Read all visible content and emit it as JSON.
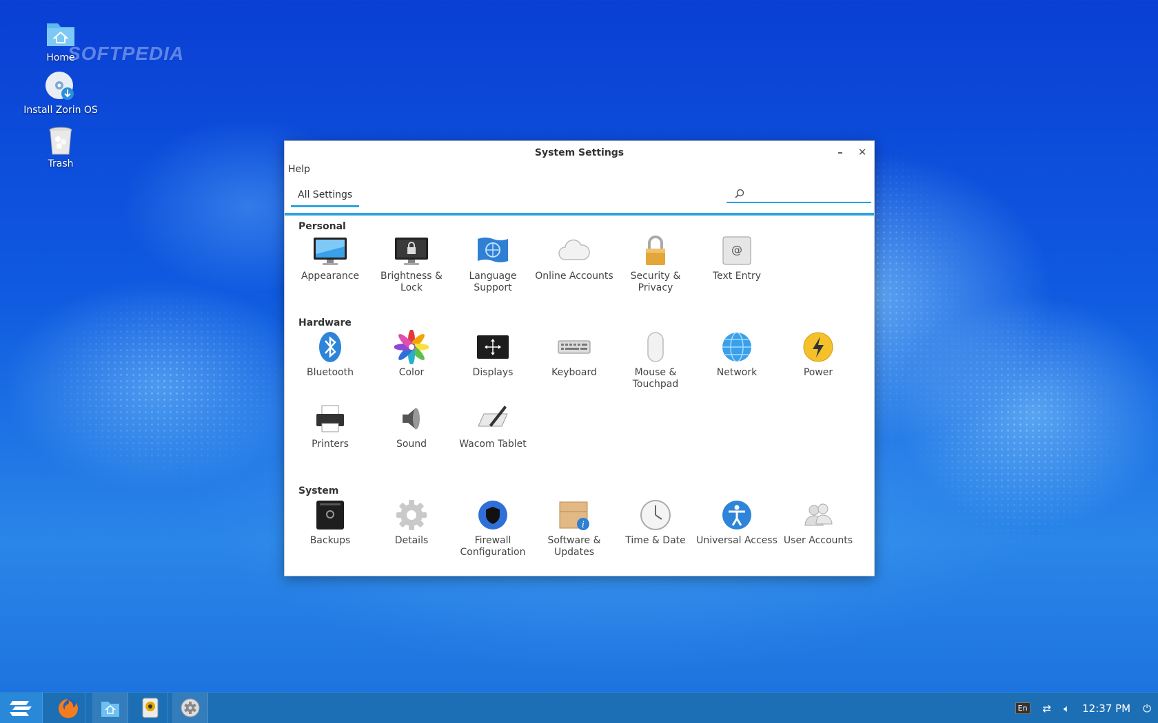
{
  "desktop": {
    "icons": [
      {
        "label": "Home",
        "icon": "home-folder-icon"
      },
      {
        "label": "Install Zorin OS",
        "icon": "install-disc-icon"
      },
      {
        "label": "Trash",
        "icon": "trash-icon"
      }
    ],
    "watermark": "SOFTPEDIA"
  },
  "window": {
    "title": "System Settings",
    "menu": {
      "help": "Help"
    },
    "tab": "All Settings",
    "search": {
      "value": "",
      "placeholder": ""
    },
    "sections": {
      "personal": {
        "title": "Personal",
        "items": [
          "Appearance",
          "Brightness & Lock",
          "Language Support",
          "Online Accounts",
          "Security & Privacy",
          "Text Entry"
        ]
      },
      "hardware": {
        "title": "Hardware",
        "items": [
          "Bluetooth",
          "Color",
          "Displays",
          "Keyboard",
          "Mouse & Touchpad",
          "Network",
          "Power",
          "Printers",
          "Sound",
          "Wacom Tablet"
        ]
      },
      "system": {
        "title": "System",
        "items": [
          "Backups",
          "Details",
          "Firewall Configuration",
          "Software & Updates",
          "Time & Date",
          "Universal Access",
          "User Accounts"
        ]
      }
    }
  },
  "taskbar": {
    "apps": [
      "zorin-menu-icon",
      "firefox-icon",
      "files-icon",
      "rhythmbox-icon",
      "settings-icon"
    ],
    "tray": {
      "lang": "En",
      "time": "12:37 PM"
    }
  },
  "colors": {
    "accent": "#2ba3e0",
    "taskbar": "#1d6fb5"
  }
}
